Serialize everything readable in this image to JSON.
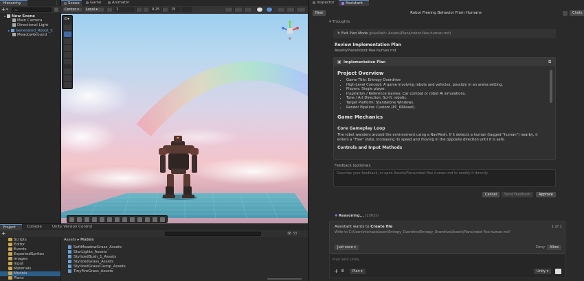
{
  "hierarchy": {
    "tab_label": "Hierarchy",
    "add_label": "+",
    "search_placeholder": "All",
    "items": [
      {
        "label": "New Scene"
      },
      {
        "label": "Main Camera"
      },
      {
        "label": "Directional Light"
      },
      {
        "label": "Generated_Robot_C"
      },
      {
        "label": "MeadowGround"
      }
    ]
  },
  "scene_tabs": [
    {
      "label": "Scene"
    },
    {
      "label": "Game"
    },
    {
      "label": "Animator"
    }
  ],
  "scene_toolbar": {
    "pivot_mode": "Center",
    "space_mode": "Local",
    "grid_value": "1",
    "snap_value": "0.25",
    "angle_value": "15"
  },
  "project": {
    "tabs": [
      {
        "label": "Project"
      },
      {
        "label": "Console"
      },
      {
        "label": "Unity Version Control"
      }
    ],
    "folders": [
      {
        "label": "Scripts"
      },
      {
        "label": "Editor"
      },
      {
        "label": "Events"
      },
      {
        "label": "ExportedSprites"
      },
      {
        "label": "Images"
      },
      {
        "label": "Input"
      },
      {
        "label": "Materials"
      },
      {
        "label": "Models"
      },
      {
        "label": "Plans"
      }
    ],
    "breadcrumb": [
      "Assets",
      "Models"
    ],
    "badge_count": "33",
    "assets": [
      {
        "label": "SoftMeadowGrass_Assets"
      },
      {
        "label": "StarLights_Assets"
      },
      {
        "label": "StylizedBush_1_Assets"
      },
      {
        "label": "StylizedGrass_Assets"
      },
      {
        "label": "StylizedGrassClump_Assets"
      },
      {
        "label": "TinyFireGrass_Assets"
      }
    ]
  },
  "right_tabs": [
    {
      "label": "Inspector"
    },
    {
      "label": "Assistant"
    }
  ],
  "assistant": {
    "new_label": "New",
    "title": "Robot Fleeing Behavior From Humans",
    "chats_label": "Chats",
    "thoughts_label": "Thoughts",
    "exit_plan": "Exit Plan Mode",
    "exit_plan_path": "(planPath: Assets/Plans/robot-flee-human.md)",
    "review_title": "Review Implementation Plan",
    "review_path": "Assets/Plans/robot-flee-human.md",
    "plan_header": "Implementation Plan",
    "overview_heading": "Project Overview",
    "overview_items": [
      "Game Title: Entropy Overdrive",
      "High-Level Concept: A game involving robots and vehicles, possibly in an arena setting.",
      "Players: Single player.",
      "Inspiration / Reference Games: Car combat or robot AI simulations.",
      "Tone / Art Direction: Sci-fi, robotic.",
      "Target Platform: Standalone Windows.",
      "Render Pipeline: Custom (PC_RPAsset)."
    ],
    "mechanics_heading": "Game Mechanics",
    "loop_heading": "Core Gameplay Loop",
    "loop_text": "The robot wanders around the environment using a NavMesh. If it detects a human (tagged \"human\") nearby, it enters a \"Flee\" state, increasing its speed and moving in the opposite direction until it is safe.",
    "controls_heading": "Controls and Input Methods",
    "feedback_label": "Feedback (optional):",
    "feedback_placeholder": "Describe your feedback, or open Assets/Plans/robot-flee-human.md to modify it directly.",
    "cancel_label": "Cancel",
    "send_feedback_label": "Send Feedback",
    "approve_label": "Approve",
    "reasoning_label": "Reasoning...",
    "reasoning_time": "(1362s)",
    "create_title_prefix": "Assistant wants to ",
    "create_title_action": "Create file",
    "create_counter": "1 of 1",
    "create_path": "Write to C:\\Users\\michaelslaven\\Entropy_Overdrive\\Entropy_Overdrive\\Assets\\Plans\\robot-flee-human.md?",
    "just_once_label": "Just once",
    "deny_label": "Deny",
    "allow_label": "Allow",
    "prompt_placeholder": "Plan with Unity",
    "mode_label": "Plan",
    "model_label": "Unity"
  }
}
